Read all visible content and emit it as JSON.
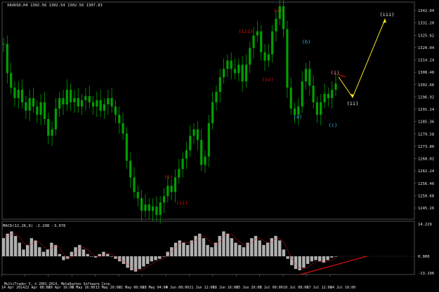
{
  "chart_header": {
    "symbol_line": "XAUUSD,H4  1302.56 1302.54 1302.56 1307.83"
  },
  "price_axis": {
    "labels": [
      "1342.04",
      "1331.20",
      "1325.62",
      "1320.04",
      "1314.24",
      "1308.48",
      "1302.66",
      "1296.92",
      "1291.14",
      "1285.36",
      "1279.58",
      "1273.80",
      "1268.02",
      "1262.24",
      "1256.46",
      "1250.68",
      "1245.26"
    ]
  },
  "indicator": {
    "label": "MACD(12,26,9) -2.298 -3.976",
    "axis_labels": [
      "14.229",
      "0.000",
      "-13.196"
    ]
  },
  "time_axis": {
    "labels": [
      "14 Apr 2014",
      "22 Apr 08:00",
      "29 Apr 16:00",
      "6 May 16:00",
      "13 May 20:00",
      "21 May 00:00",
      "28 May 04:00",
      "4 Jun 08:00",
      "11 Jun 12:00",
      "18 Jun 16:00",
      "25 Jun 20:00",
      "3 Jul 00:00",
      "10 Jul 08:00",
      "17 Jul 12:00",
      "24 Jul 16:00"
    ]
  },
  "footer": {
    "copyright": "MultiTrader 5, © 2001-2014, MetaQuotes Software Corp."
  },
  "wave_labels": {
    "i_red": "(i)",
    "ii_red": "(ii)",
    "iii_red": "(iii)",
    "iv_red": "(iv)",
    "v_red": "(v)",
    "a": "(a)",
    "b": "(b)",
    "c": "(c)",
    "i_pink": "(i)",
    "ii_white": "(ii)",
    "iii_white": "(iii)"
  },
  "colors": {
    "background": "#000000",
    "candles": "#00a000",
    "wave_red": "#e01010",
    "wave_cyan": "#30b8e0",
    "projection": "#f0e020",
    "macd_hist": "#b0b0b0",
    "macd_signal": "#ff2020"
  },
  "chart_data": {
    "type": "line",
    "series": [
      {
        "values": [
          1326,
          1312,
          1305,
          1300,
          1304,
          1298,
          1294,
          1300,
          1296,
          1292,
          1298,
          1290,
          1282,
          1285,
          1295,
          1300,
          1297,
          1304,
          1298,
          1300,
          1296,
          1299,
          1301,
          1298,
          1296,
          1299,
          1294,
          1297,
          1300,
          1296,
          1292,
          1288,
          1283,
          1270,
          1262,
          1255,
          1252,
          1246,
          1249,
          1246,
          1248,
          1244,
          1250,
          1253,
          1258,
          1255,
          1262,
          1266,
          1271,
          1275,
          1282,
          1285,
          1280,
          1268,
          1272,
          1288,
          1298,
          1303,
          1310,
          1314,
          1318,
          1314,
          1312,
          1316,
          1308,
          1316,
          1324,
          1330,
          1332,
          1322,
          1318,
          1321,
          1332,
          1338,
          1344,
          1333,
          1305,
          1295,
          1292,
          1296,
          1308,
          1314,
          1306,
          1298,
          1292,
          1298,
          1302,
          1300,
          1304,
          1307
        ],
        "ylim": [
          1242,
          1346
        ]
      }
    ],
    "macd": {
      "histogram": [
        8,
        10,
        11,
        9,
        6,
        3,
        5,
        8,
        7,
        4,
        2,
        3,
        6,
        5,
        1,
        -3,
        -2,
        2,
        4,
        5,
        3,
        1,
        0,
        -1,
        1,
        2,
        1,
        0,
        -2,
        -4,
        -6,
        -9,
        -11,
        -12,
        -10,
        -8,
        -6,
        -4,
        -3,
        -2,
        0,
        2,
        4,
        6,
        7,
        6,
        5,
        7,
        9,
        10,
        8,
        5,
        4,
        6,
        9,
        11,
        10,
        8,
        6,
        5,
        4,
        6,
        8,
        9,
        7,
        5,
        6,
        8,
        9,
        7,
        3,
        -2,
        -7,
        -10,
        -11,
        -9,
        -6,
        -4,
        -3,
        -4,
        -5,
        -3,
        -1,
        0
      ],
      "ylim": [
        -13.196,
        14.229
      ]
    }
  }
}
